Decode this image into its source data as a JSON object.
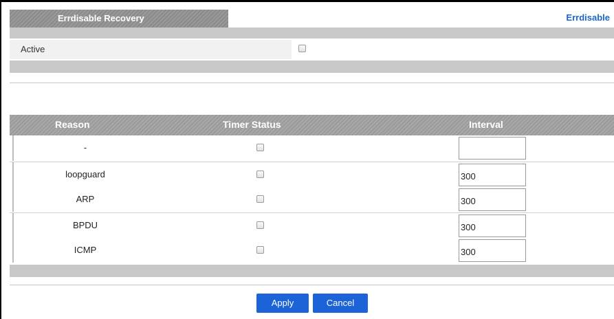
{
  "header": {
    "tab_title": "Errdisable Recovery",
    "link_label": "Errdisable"
  },
  "active": {
    "label": "Active",
    "checked": false
  },
  "table": {
    "columns": [
      "Reason",
      "Timer Status",
      "Interval"
    ],
    "rows": [
      {
        "reason": "-",
        "timer_status": false,
        "interval": ""
      },
      {
        "reason": "loopguard",
        "timer_status": false,
        "interval": "300"
      },
      {
        "reason": "ARP",
        "timer_status": false,
        "interval": "300"
      },
      {
        "reason": "BPDU",
        "timer_status": false,
        "interval": "300"
      },
      {
        "reason": "ICMP",
        "timer_status": false,
        "interval": "300"
      }
    ]
  },
  "buttons": {
    "apply": "Apply",
    "cancel": "Cancel"
  }
}
